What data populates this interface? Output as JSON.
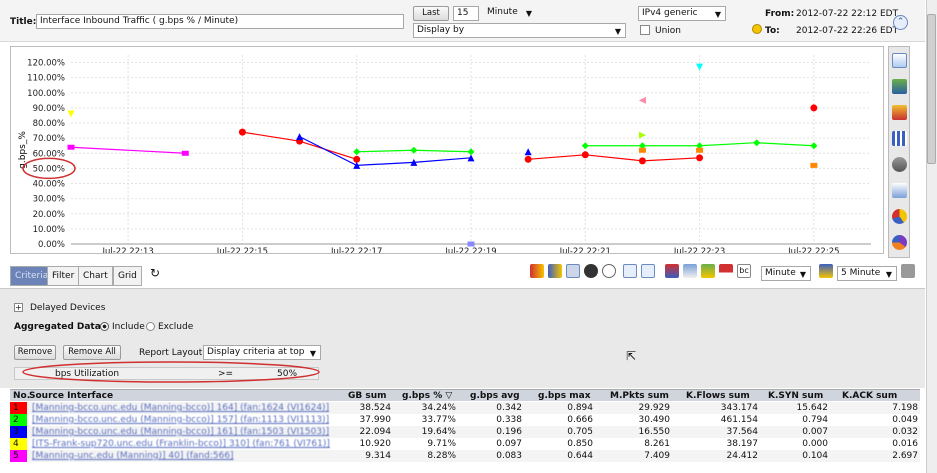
{
  "header": {
    "title_label": "Title:",
    "title_value": "Interface Inbound Traffic ( g.bps % / Minute)",
    "last_label": "Last",
    "last_value": "15",
    "unit_value": "Minute",
    "display_by_value": "Display by",
    "ipv_value": "IPv4 generic",
    "union_label": "Union",
    "from_label": "From:",
    "from_value": "2012-07-22 22:12 EDT",
    "to_label": "To:",
    "to_value": "2012-07-22 22:26 EDT"
  },
  "chart_data": {
    "type": "line",
    "ylabel": "g.bps_%",
    "yticks": [
      "120.00%",
      "110.00%",
      "100.00%",
      "90.00%",
      "80.00%",
      "70.00%",
      "60.00%",
      "50.00%",
      "40.00%",
      "30.00%",
      "20.00%",
      "10.00%",
      "0.00%"
    ],
    "ylim": [
      0,
      125
    ],
    "xticks": [
      "Jul-22 22:13",
      "Jul-22 22:15",
      "Jul-22 22:17",
      "Jul-22 22:19",
      "Jul-22 22:21",
      "Jul-22 22:23",
      "Jul-22 22:25"
    ],
    "x_range": [
      "Jul-22 22:12",
      "Jul-22 22:26"
    ],
    "grid": true,
    "series": [
      {
        "color": "#ff00ff",
        "marker": "square",
        "points": [
          [
            "Jul-22 22:12",
            64
          ],
          [
            "Jul-22 22:14",
            60
          ]
        ]
      },
      {
        "color": "#ff0000",
        "marker": "circle",
        "points": [
          [
            "Jul-22 22:15",
            74
          ],
          [
            "Jul-22 22:16",
            68
          ],
          [
            "Jul-22 22:17",
            56
          ]
        ]
      },
      {
        "color": "#ff0000",
        "marker": "circle",
        "points": [
          [
            "Jul-22 22:20",
            56
          ],
          [
            "Jul-22 22:21",
            59
          ],
          [
            "Jul-22 22:22",
            55
          ],
          [
            "Jul-22 22:23",
            57
          ]
        ]
      },
      {
        "color": "#0000ff",
        "marker": "triangle",
        "points": [
          [
            "Jul-22 22:16",
            71
          ],
          [
            "Jul-22 22:17",
            52
          ],
          [
            "Jul-22 22:18",
            54
          ],
          [
            "Jul-22 22:19",
            57
          ]
        ]
      },
      {
        "color": "#00ff00",
        "marker": "diamond",
        "points": [
          [
            "Jul-22 22:17",
            61
          ],
          [
            "Jul-22 22:18",
            62
          ],
          [
            "Jul-22 22:19",
            61
          ]
        ]
      },
      {
        "color": "#00ff00",
        "marker": "diamond",
        "points": [
          [
            "Jul-22 22:21",
            65
          ],
          [
            "Jul-22 22:22",
            65
          ],
          [
            "Jul-22 22:23",
            65
          ],
          [
            "Jul-22 22:24",
            67
          ],
          [
            "Jul-22 22:25",
            65
          ]
        ]
      }
    ],
    "isolated_points": [
      {
        "x": "Jul-22 22:12",
        "y": 86,
        "color": "#ffff00",
        "marker": "triangle-down"
      },
      {
        "x": "Jul-22 22:20",
        "y": 61,
        "color": "#0000ff",
        "marker": "triangle"
      },
      {
        "x": "Jul-22 22:19",
        "y": 0,
        "color": "#8888ff",
        "marker": "square"
      },
      {
        "x": "Jul-22 22:22",
        "y": 95,
        "color": "#ff88aa",
        "marker": "triangle-left"
      },
      {
        "x": "Jul-22 22:22",
        "y": 72,
        "color": "#aaff00",
        "marker": "triangle-right"
      },
      {
        "x": "Jul-22 22:22",
        "y": 62,
        "color": "#ff8800",
        "marker": "square"
      },
      {
        "x": "Jul-22 22:23",
        "y": 117,
        "color": "#00ffff",
        "marker": "triangle-down"
      },
      {
        "x": "Jul-22 22:23",
        "y": 62,
        "color": "#ff8800",
        "marker": "square"
      },
      {
        "x": "Jul-22 22:25",
        "y": 90,
        "color": "#ff0000",
        "marker": "circle"
      },
      {
        "x": "Jul-22 22:25",
        "y": 52,
        "color": "#ff8800",
        "marker": "square"
      }
    ],
    "annotation": {
      "label": "50.00%",
      "style": "red-ellipse"
    }
  },
  "tabs": [
    {
      "label": "Criteria",
      "active": true
    },
    {
      "label": "Filter",
      "active": false
    },
    {
      "label": "Chart",
      "active": false
    },
    {
      "label": "Grid",
      "active": false
    }
  ],
  "toolbar": {
    "minute_value": "Minute",
    "five_minute_value": "5 Minute"
  },
  "criteria": {
    "delayed_label": "Delayed Devices",
    "aggregated_label": "Aggregated Data",
    "include_label": "Include",
    "exclude_label": "Exclude",
    "remove_label": "Remove",
    "remove_all_label": "Remove All",
    "report_layout_label": "Report Layout",
    "report_layout_value": "Display criteria at top",
    "filter_row": {
      "name": "bps Utilization",
      "op": ">=",
      "value": "50%"
    }
  },
  "table": {
    "columns": [
      "No.",
      "Source Interface",
      "GB sum",
      "g.bps % ▽",
      "g.bps avg",
      "g.bps max",
      "M.Pkts sum",
      "K.Flows sum",
      "K.SYN sum",
      "K.ACK sum"
    ],
    "rows": [
      {
        "no": "1",
        "color": "#ff0000",
        "iface": "[Manning-bcco.unc.edu (Manning-bcco)] 164] (fan:1624 (VI1624)]",
        "gb": "38.524",
        "pct": "34.24%",
        "avg": "0.342",
        "max": "0.894",
        "pkts": "29.929",
        "flows": "343.174",
        "syn": "15.642",
        "ack": "7.198"
      },
      {
        "no": "2",
        "color": "#00ff00",
        "iface": "[Manning-bcco.unc.edu (Manning-bcco)] 157] (fan:1113 (VI1113)]",
        "gb": "37.990",
        "pct": "33.77%",
        "avg": "0.338",
        "max": "0.666",
        "pkts": "30.490",
        "flows": "461.154",
        "syn": "0.794",
        "ack": "0.049"
      },
      {
        "no": "3",
        "color": "#0000ff",
        "iface": "[Manning-bcco.unc.edu (Manning-bcco)] 161] (fan:1503 (VI1503)]",
        "gb": "22.094",
        "pct": "19.64%",
        "avg": "0.196",
        "max": "0.705",
        "pkts": "16.550",
        "flows": "37.564",
        "syn": "0.007",
        "ack": "0.032"
      },
      {
        "no": "4",
        "color": "#ffff00",
        "iface": "[ITS-Frank-sup720.unc.edu (Franklin-bcco)] 310] (fan:761 (VI761)]",
        "gb": "10.920",
        "pct": "9.71%",
        "avg": "0.097",
        "max": "0.850",
        "pkts": "8.261",
        "flows": "38.197",
        "syn": "0.000",
        "ack": "0.016"
      },
      {
        "no": "5",
        "color": "#ff00ff",
        "iface": "[Manning-unc.edu (Manning)] 40] (fand:566]",
        "gb": "9.314",
        "pct": "8.28%",
        "avg": "0.083",
        "max": "0.644",
        "pkts": "7.409",
        "flows": "24.412",
        "syn": "0.104",
        "ack": "2.697"
      }
    ]
  }
}
